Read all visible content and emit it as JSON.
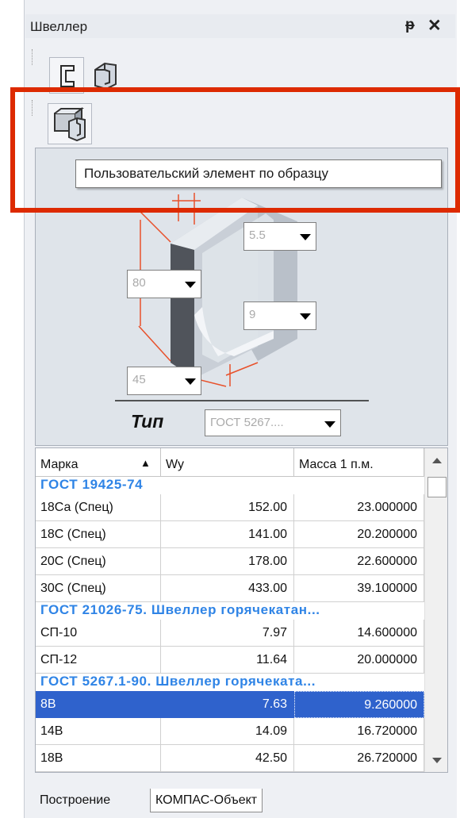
{
  "window": {
    "title": "Швеллер",
    "pin_icon": "pin-icon",
    "close_icon": "close-icon"
  },
  "toolbar": {
    "row1": [
      "channel-profile-icon",
      "channel-3d-icon"
    ],
    "row2": [
      "custom-element-icon"
    ]
  },
  "tooltip": "Пользовательский элемент по образцу",
  "params": {
    "thickness": "5.5",
    "height": "80",
    "flange": "9",
    "width": "45",
    "type_label": "Тип",
    "type_value": "ГОСТ 5267...."
  },
  "table": {
    "columns": [
      "Марка",
      "Wy",
      "Масса 1 п.м."
    ],
    "sort_indicator": "▲",
    "groups": [
      {
        "title": "ГОСТ 19425-74",
        "rows": [
          [
            "18Са (Спец)",
            "152.00",
            "23.000000"
          ],
          [
            "18С (Спец)",
            "141.00",
            "20.200000"
          ],
          [
            "20С (Спец)",
            "178.00",
            "22.600000"
          ],
          [
            "30С (Спец)",
            "433.00",
            "39.100000"
          ]
        ]
      },
      {
        "title": "ГОСТ 21026-75. Швеллер горячекатан...",
        "rows": [
          [
            "СП-10",
            "7.97",
            "14.600000"
          ],
          [
            "СП-12",
            "11.64",
            "20.000000"
          ]
        ]
      },
      {
        "title": "ГОСТ 5267.1-90. Швеллер горячеката...",
        "rows": [
          [
            "8В",
            "7.63",
            "9.260000"
          ],
          [
            "14В",
            "14.09",
            "16.720000"
          ],
          [
            "18В",
            "42.50",
            "26.720000"
          ]
        ]
      }
    ],
    "selected_row": "8В"
  },
  "tabs": [
    "Построение",
    "КОМПАС-Объект"
  ],
  "colors": {
    "highlight_box": "#dd2a00",
    "group_header": "#2f84e6",
    "selection": "#2f62cc",
    "dimension_lines": "#e8502a"
  }
}
